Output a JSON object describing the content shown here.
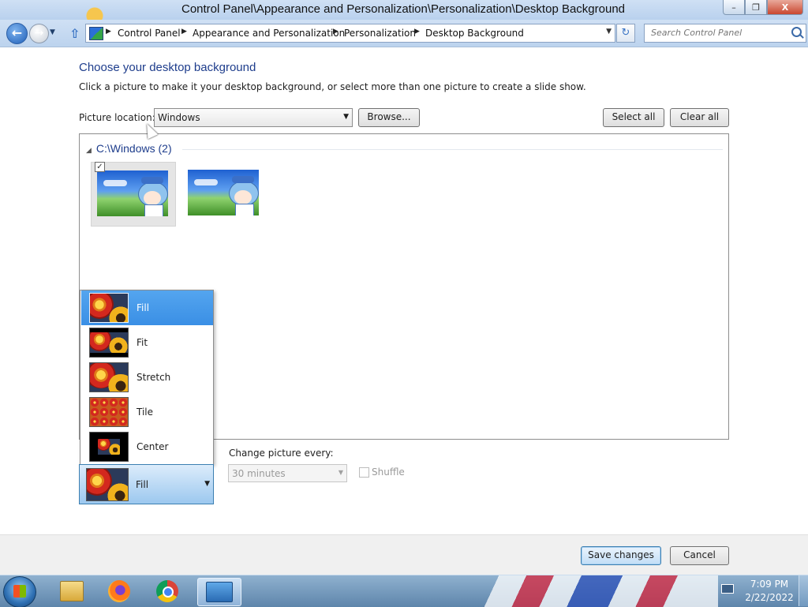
{
  "window": {
    "title": "Control Panel\\Appearance and Personalization\\Personalization\\Desktop Background",
    "minimize_icon": "minimize-icon",
    "restore_icon": "restore-icon",
    "close_icon": "close-icon",
    "close_label": "X"
  },
  "navbar": {
    "breadcrumbs": [
      "Control Panel",
      "Appearance and Personalization",
      "Personalization",
      "Desktop Background"
    ],
    "search_placeholder": "Search Control Panel"
  },
  "content": {
    "title": "Choose your desktop background",
    "description": "Click a picture to make it your desktop background, or select more than one picture to create a slide show.",
    "picture_location_label": "Picture location:",
    "picture_location_value": "Windows",
    "browse_label": "Browse...",
    "select_all_label": "Select all",
    "clear_all_label": "Clear all",
    "group_header": "C:\\Windows (2)",
    "thumbnails": [
      {
        "checked": true,
        "selected": true
      },
      {
        "checked": false,
        "selected": false
      }
    ]
  },
  "picture_position": {
    "options": [
      "Fill",
      "Fit",
      "Stretch",
      "Tile",
      "Center"
    ],
    "highlighted": "Fill",
    "selected": "Fill"
  },
  "slideshow": {
    "change_label": "Change picture every:",
    "interval_value": "30 minutes",
    "shuffle_label": "Shuffle",
    "shuffle_checked": false
  },
  "footer": {
    "save_label": "Save changes",
    "cancel_label": "Cancel"
  },
  "taskbar": {
    "apps": [
      "start-orb",
      "windows-explorer",
      "firefox",
      "chrome",
      "control-panel"
    ],
    "time": "7:09 PM",
    "date": "2/22/2022"
  },
  "colors": {
    "title_blue": "#1e3d8c",
    "selection_blue": "#3a8fe5",
    "taskbar": "#5e85ab"
  }
}
